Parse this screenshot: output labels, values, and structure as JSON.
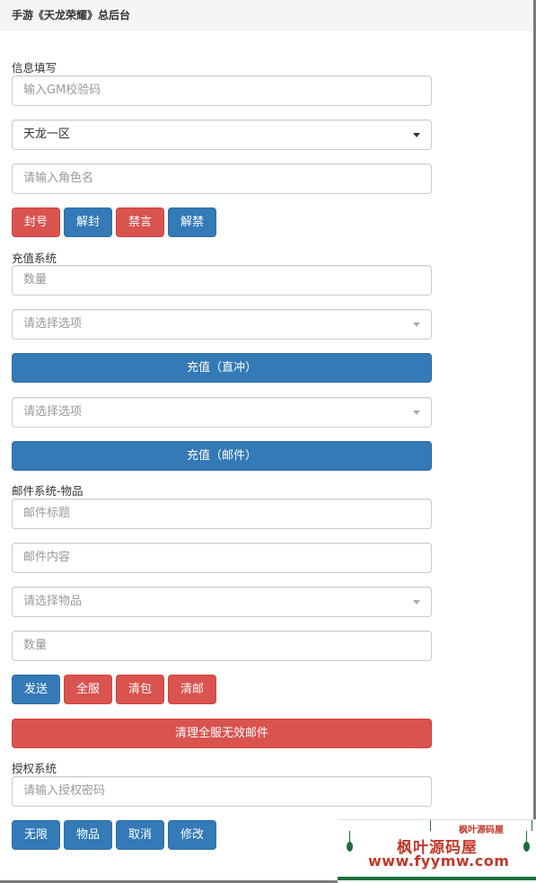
{
  "header": {
    "title": "手游《天龙荣耀》总后台"
  },
  "info": {
    "section_label": "信息填写",
    "gm_code_placeholder": "输入GM校验码",
    "server_value": "天龙一区",
    "role_name_placeholder": "请输入角色名",
    "buttons": [
      "封号",
      "解封",
      "禁言",
      "解禁"
    ]
  },
  "recharge": {
    "section_label": "充值系统",
    "amount_placeholder": "数量",
    "option1_placeholder": "请选择选项",
    "direct_button": "充值（直冲）",
    "option2_placeholder": "请选择选项",
    "mail_button": "充值（邮件）"
  },
  "mail": {
    "section_label": "邮件系统-物品",
    "title_placeholder": "邮件标题",
    "content_placeholder": "邮件内容",
    "item_placeholder": "请选择物品",
    "quantity_placeholder": "数量",
    "buttons": [
      "发送",
      "全服",
      "清包",
      "清邮"
    ],
    "clear_invalid_button": "清理全服无效邮件"
  },
  "auth": {
    "section_label": "授权系统",
    "password_placeholder": "请输入授权密码",
    "buttons": [
      "无限",
      "物品",
      "取消",
      "修改"
    ]
  },
  "watermark": {
    "top_text": "枫叶源码屋",
    "name": "枫叶源码屋",
    "url": "www.fyymw.com"
  },
  "colors": {
    "primary": "#337ab7",
    "danger": "#d9534f",
    "watermark_text": "#c0392b",
    "watermark_accent": "#1d6e3a"
  }
}
